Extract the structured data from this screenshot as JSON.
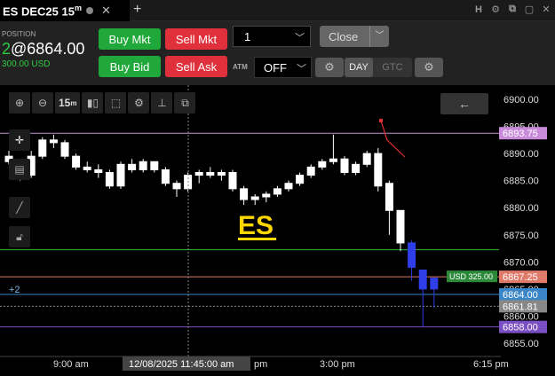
{
  "tab": {
    "symbol": "ES DEC25",
    "timeframe": "15",
    "timeframe_unit": "m",
    "close_icon": "close-icon",
    "add_icon": "plus-icon",
    "tools": [
      "H",
      "gear-icon",
      "link-icon",
      "window-icon",
      "close-icon"
    ]
  },
  "position": {
    "label": "POSITION",
    "qty": "2",
    "price": "@6864.00",
    "pnl": "300.00 USD"
  },
  "order": {
    "buy_mkt": "Buy Mkt",
    "sell_mkt": "Sell Mkt",
    "buy_bid": "Buy Bid",
    "sell_ask": "Sell Ask",
    "quantity": "1",
    "close_label": "Close",
    "atm_label": "ATM",
    "atm_value": "OFF",
    "tif_day": "DAY",
    "tif_gtc": "GTC"
  },
  "colors": {
    "bull": "#ffffff",
    "bear": "#ffffff",
    "live_candles": "#2f3ee8",
    "purple_line": "#c98bd9",
    "green_line": "#33b233",
    "red_line": "#e05040",
    "blue_line": "#3a86c8",
    "dark_purple_line": "#7b4fc4",
    "watermark": "#ffd700"
  },
  "chart": {
    "timeframe_button": "15",
    "timeframe_button_unit": "m",
    "watermark": "ES",
    "position_marker": "+2",
    "crosshair_time": "12/08/2025 11:45:00 am",
    "x_labels": [
      "9:00 am",
      "pm",
      "3:00 pm",
      "6:15 pm"
    ]
  },
  "chart_data": {
    "type": "candlestick",
    "y_ticks": [
      "6900.00",
      "6895.00",
      "6890.00",
      "6885.00",
      "6880.00",
      "6875.00",
      "6870.00",
      "6865.00",
      "6860.00",
      "6855.00"
    ],
    "ylim": [
      6853.5,
      6902.5
    ],
    "price_lines": [
      {
        "price": 6893.75,
        "label": "6893.75",
        "color": "#c98bd9"
      },
      {
        "price": 6872.25,
        "label": "",
        "color": "#33b233"
      },
      {
        "price": 6867.25,
        "label": "6867.25",
        "color": "#e07a6a",
        "tag": "USD 325.00"
      },
      {
        "price": 6864.0,
        "label": "6864.00",
        "color": "#3a86c8"
      },
      {
        "price": 6861.81,
        "label": "6861.81",
        "color": "#888888"
      },
      {
        "price": 6858.0,
        "label": "6858.00",
        "color": "#7b4fc4"
      }
    ],
    "candles": [
      {
        "o": 6889.5,
        "h": 6890.5,
        "l": 6888.0,
        "c": 6888.5
      },
      {
        "o": 6888.0,
        "h": 6889.0,
        "l": 6885.0,
        "c": 6885.5
      },
      {
        "o": 6886.0,
        "h": 6890.5,
        "l": 6885.5,
        "c": 6889.5
      },
      {
        "o": 6889.5,
        "h": 6893.0,
        "l": 6889.0,
        "c": 6892.5
      },
      {
        "o": 6892.5,
        "h": 6893.5,
        "l": 6891.0,
        "c": 6892.0
      },
      {
        "o": 6892.0,
        "h": 6892.5,
        "l": 6889.0,
        "c": 6889.5
      },
      {
        "o": 6889.5,
        "h": 6890.0,
        "l": 6887.0,
        "c": 6887.5
      },
      {
        "o": 6887.5,
        "h": 6888.5,
        "l": 6886.5,
        "c": 6887.0
      },
      {
        "o": 6887.0,
        "h": 6888.0,
        "l": 6885.5,
        "c": 6886.5
      },
      {
        "o": 6886.5,
        "h": 6887.0,
        "l": 6883.5,
        "c": 6884.0
      },
      {
        "o": 6884.0,
        "h": 6888.5,
        "l": 6883.5,
        "c": 6888.0
      },
      {
        "o": 6888.0,
        "h": 6889.0,
        "l": 6886.5,
        "c": 6887.0
      },
      {
        "o": 6887.0,
        "h": 6889.0,
        "l": 6886.5,
        "c": 6888.5
      },
      {
        "o": 6888.5,
        "h": 6888.5,
        "l": 6886.5,
        "c": 6887.0
      },
      {
        "o": 6887.0,
        "h": 6887.5,
        "l": 6884.0,
        "c": 6884.5
      },
      {
        "o": 6884.5,
        "h": 6885.0,
        "l": 6882.0,
        "c": 6883.5
      },
      {
        "o": 6883.5,
        "h": 6886.5,
        "l": 6883.0,
        "c": 6886.0
      },
      {
        "o": 6886.0,
        "h": 6887.0,
        "l": 6884.5,
        "c": 6886.5
      },
      {
        "o": 6886.5,
        "h": 6887.5,
        "l": 6885.5,
        "c": 6886.0
      },
      {
        "o": 6886.0,
        "h": 6887.0,
        "l": 6885.0,
        "c": 6886.5
      },
      {
        "o": 6886.5,
        "h": 6887.0,
        "l": 6883.0,
        "c": 6883.5
      },
      {
        "o": 6883.5,
        "h": 6884.0,
        "l": 6880.5,
        "c": 6881.5
      },
      {
        "o": 6881.5,
        "h": 6882.5,
        "l": 6880.5,
        "c": 6882.0
      },
      {
        "o": 6882.0,
        "h": 6883.0,
        "l": 6881.0,
        "c": 6882.5
      },
      {
        "o": 6882.5,
        "h": 6884.0,
        "l": 6882.0,
        "c": 6883.5
      },
      {
        "o": 6883.5,
        "h": 6885.0,
        "l": 6883.0,
        "c": 6884.5
      },
      {
        "o": 6884.5,
        "h": 6886.5,
        "l": 6884.0,
        "c": 6886.0
      },
      {
        "o": 6886.0,
        "h": 6888.0,
        "l": 6885.5,
        "c": 6887.5
      },
      {
        "o": 6887.5,
        "h": 6889.0,
        "l": 6887.0,
        "c": 6888.5
      },
      {
        "o": 6888.5,
        "h": 6893.5,
        "l": 6888.0,
        "c": 6889.0
      },
      {
        "o": 6889.0,
        "h": 6889.5,
        "l": 6886.0,
        "c": 6886.5
      },
      {
        "o": 6886.5,
        "h": 6888.5,
        "l": 6886.0,
        "c": 6888.0
      },
      {
        "o": 6888.0,
        "h": 6890.5,
        "l": 6887.5,
        "c": 6890.0
      },
      {
        "o": 6890.0,
        "h": 6891.0,
        "l": 6883.0,
        "c": 6884.0
      },
      {
        "o": 6884.5,
        "h": 6885.0,
        "l": 6875.0,
        "c": 6879.5
      },
      {
        "o": 6879.5,
        "h": 6879.5,
        "l": 6872.0,
        "c": 6873.5
      },
      {
        "o": 6873.5,
        "h": 6874.0,
        "l": 6866.5,
        "c": 6869.0
      },
      {
        "o": 6868.5,
        "h": 6868.5,
        "l": 6858.0,
        "c": 6865.0
      },
      {
        "o": 6867.0,
        "h": 6867.0,
        "l": 6861.5,
        "c": 6865.0
      }
    ],
    "live_candles_from": 36
  }
}
